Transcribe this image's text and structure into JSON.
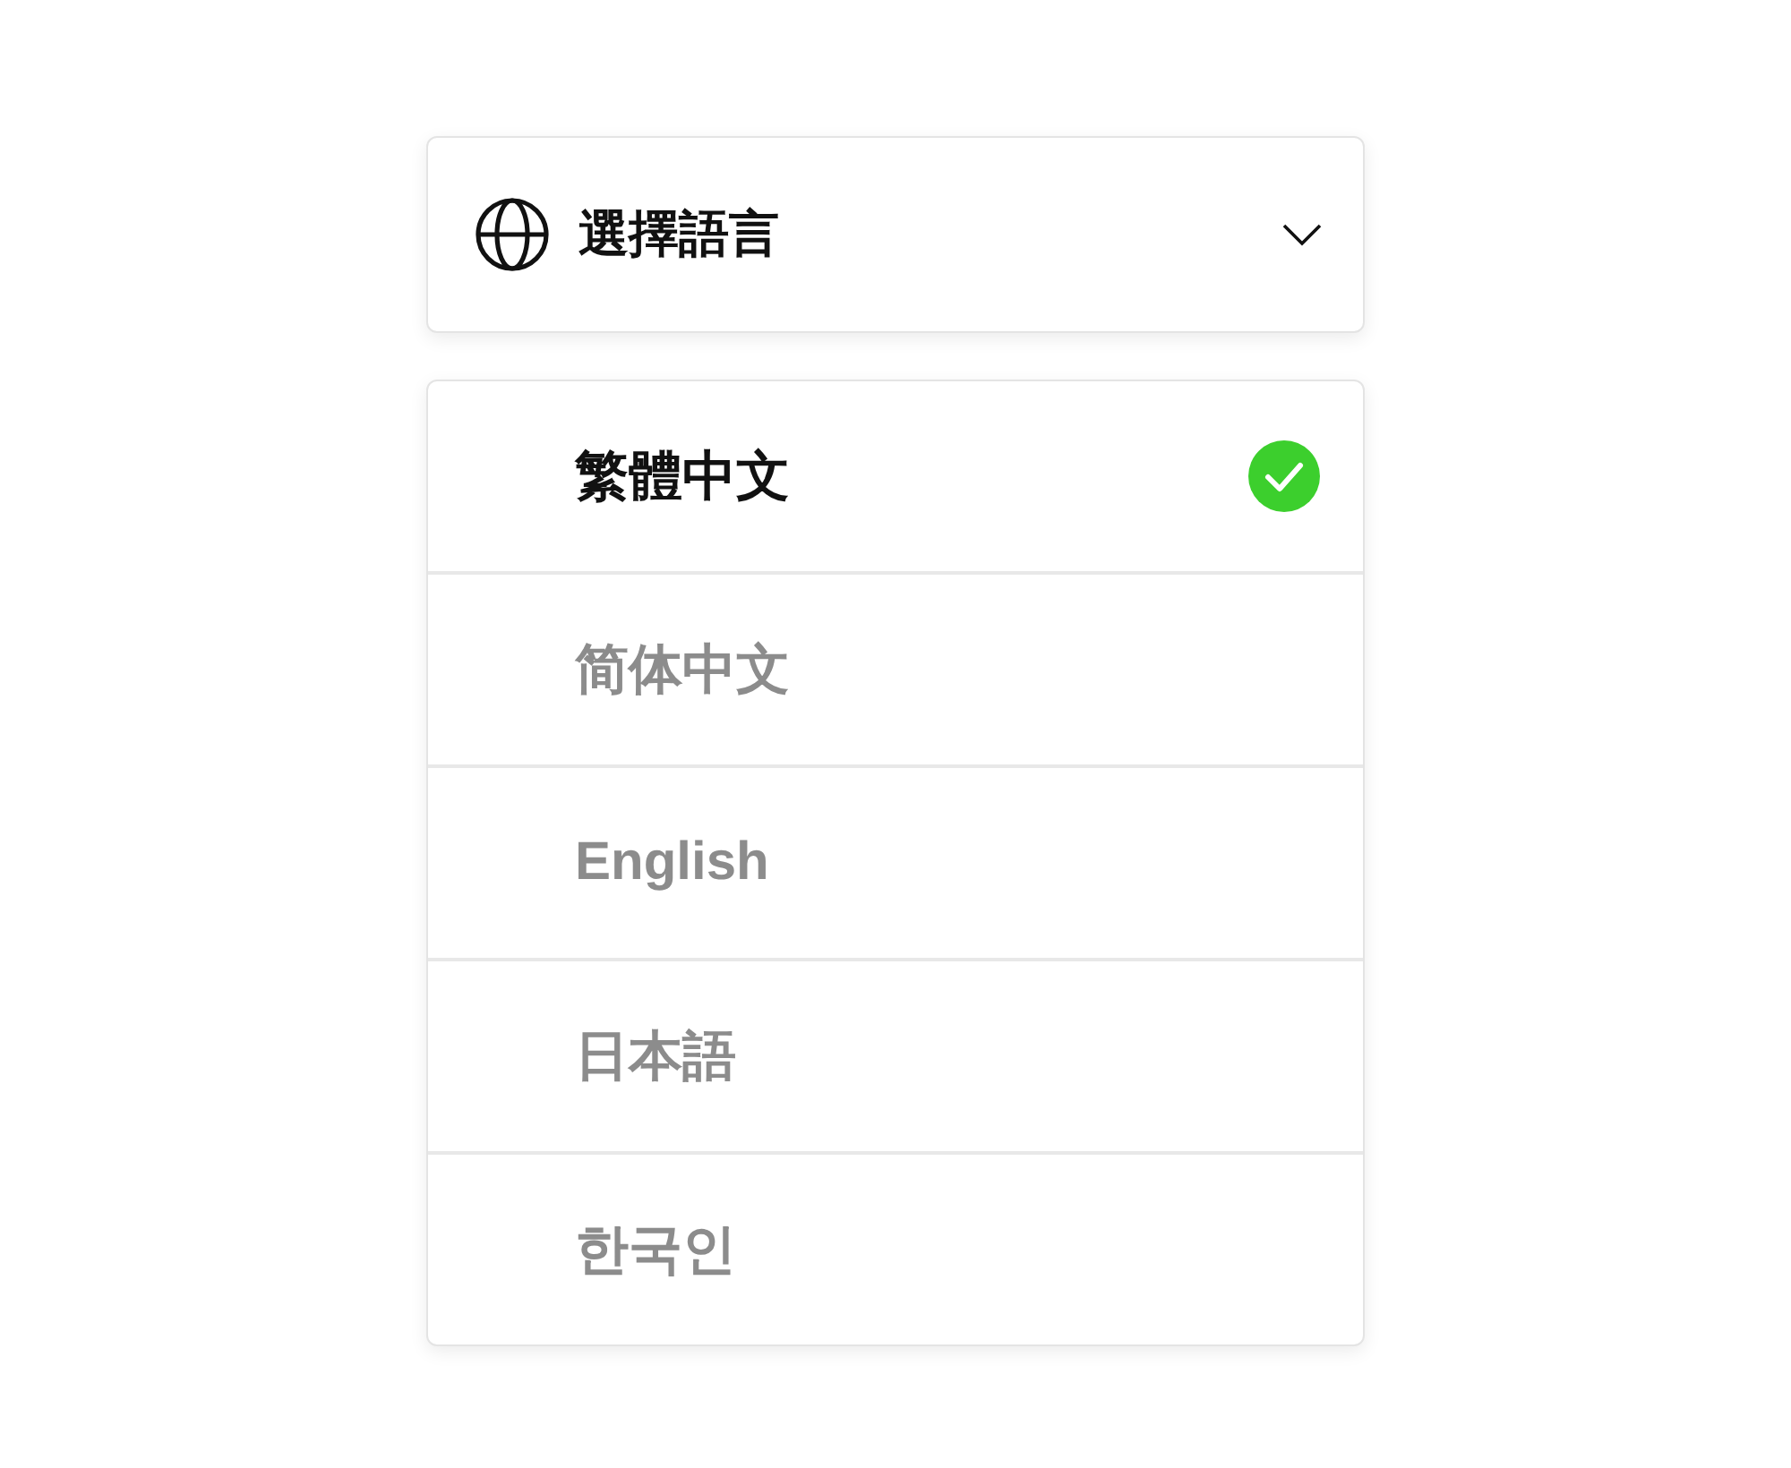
{
  "header": {
    "title": "選擇語言",
    "expanded": true
  },
  "languages": [
    {
      "label": "繁體中文",
      "selected": true
    },
    {
      "label": "简体中文",
      "selected": false
    },
    {
      "label": "English",
      "selected": false
    },
    {
      "label": "日本語",
      "selected": false
    },
    {
      "label": "한국인",
      "selected": false
    }
  ]
}
